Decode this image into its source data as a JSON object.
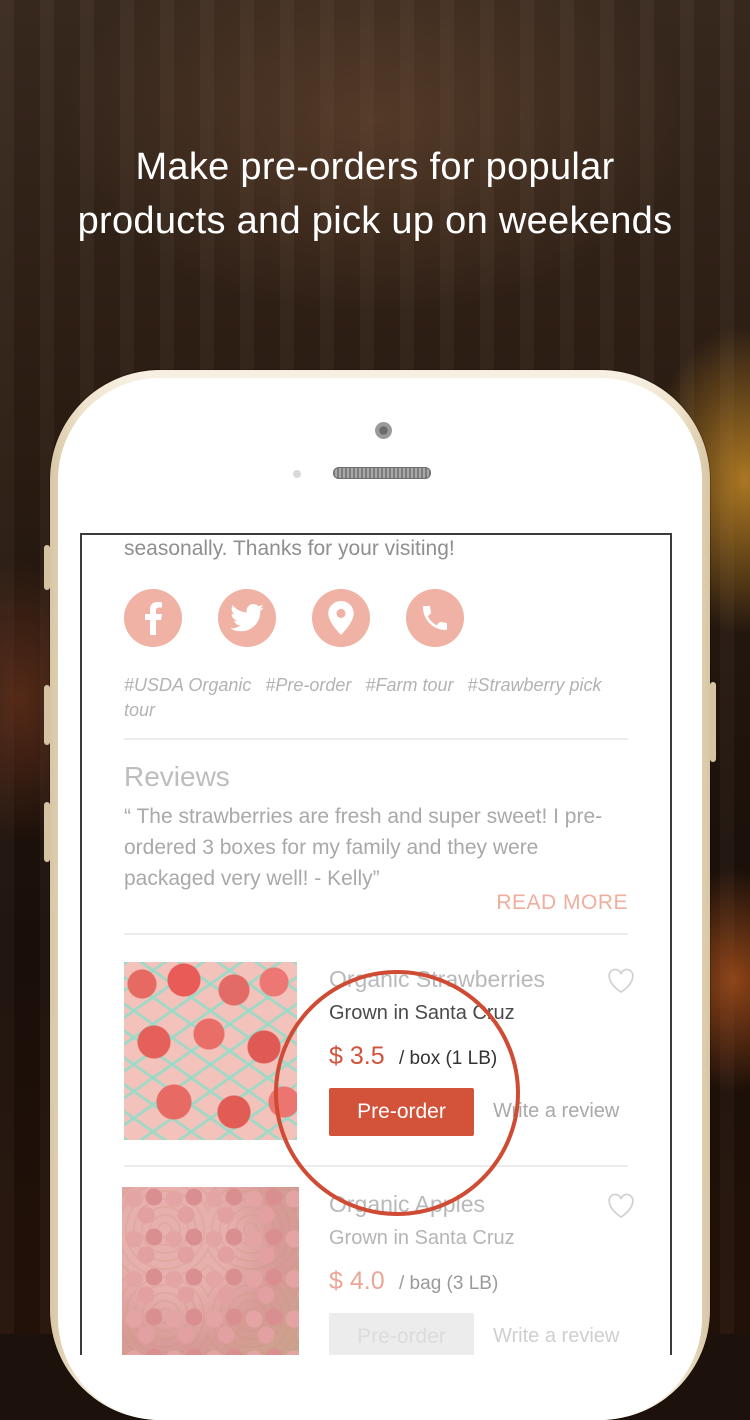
{
  "headline": {
    "line1": "Make pre-orders for popular",
    "line2": "products and pick up on weekends"
  },
  "intro_text": "seasonally. Thanks for your visiting!",
  "social": [
    {
      "icon": "facebook-icon",
      "name": "social-facebook-button"
    },
    {
      "icon": "twitter-icon",
      "name": "social-twitter-button"
    },
    {
      "icon": "location-pin-icon",
      "name": "social-location-button"
    },
    {
      "icon": "phone-icon",
      "name": "social-phone-button"
    }
  ],
  "tags": [
    "#USDA Organic",
    "#Pre-order",
    "#Farm tour",
    "#Strawberry pick tour"
  ],
  "reviews": {
    "title": "Reviews",
    "text": "“ The strawberries are fresh and super sweet! I pre-ordered 3 boxes for my family and they were packaged very well!  - Kelly”",
    "read_more": "READ MORE"
  },
  "products": [
    {
      "name": "Organic Strawberries",
      "origin": "Grown in Santa Cruz",
      "price": "$ 3.5",
      "unit": "/ box (1 LB)",
      "button": "Pre-order",
      "write_review": "Write a review"
    },
    {
      "name": "Organic Apples",
      "origin": "Grown in Santa Cruz",
      "price": "$ 4.0",
      "unit": "/ bag (3 LB)",
      "button": "Pre-order",
      "write_review": "Write a review"
    }
  ],
  "colors": {
    "accent": "#d2533a",
    "accent_light": "#efb2a4",
    "muted_text": "#a9a9a9"
  }
}
